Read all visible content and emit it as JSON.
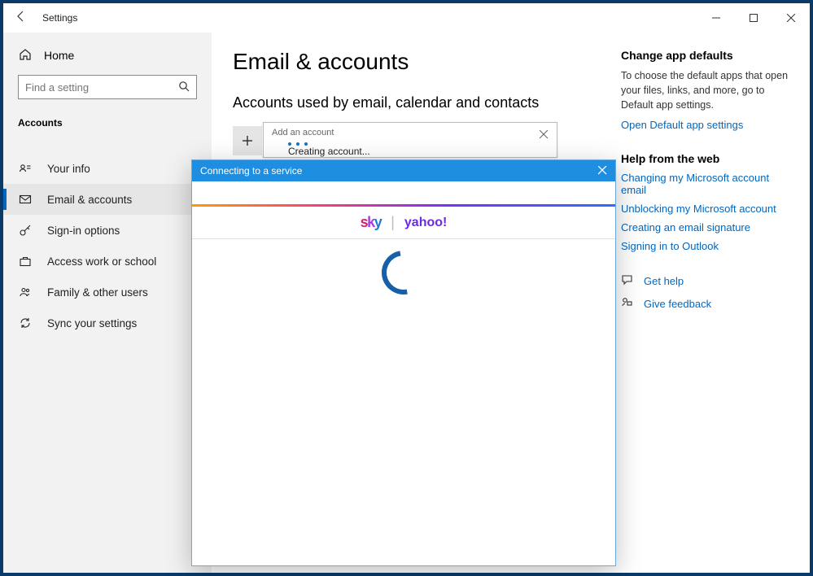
{
  "window": {
    "title": "Settings"
  },
  "sidebar": {
    "home": "Home",
    "search_placeholder": "Find a setting",
    "section": "Accounts",
    "items": [
      {
        "label": "Your info"
      },
      {
        "label": "Email & accounts"
      },
      {
        "label": "Sign-in options"
      },
      {
        "label": "Access work or school"
      },
      {
        "label": "Family & other users"
      },
      {
        "label": "Sync your settings"
      }
    ]
  },
  "main": {
    "title": "Email & accounts",
    "section_heading": "Accounts used by email, calendar and contacts",
    "add_account_label": "Add an account"
  },
  "aside": {
    "defaults_heading": "Change app defaults",
    "defaults_desc": "To choose the default apps that open your files, links, and more, go to Default app settings.",
    "open_defaults_link": "Open Default app settings",
    "help_heading": "Help from the web",
    "help_links": [
      "Changing my Microsoft account email",
      "Unblocking my Microsoft account",
      "Creating an email signature",
      "Signing in to Outlook"
    ],
    "get_help": "Get help",
    "give_feedback": "Give feedback"
  },
  "popup": {
    "title": "Add an account",
    "message": "Creating account..."
  },
  "dialog": {
    "title": "Connecting to a service",
    "brand_left": "sky",
    "brand_right": "yahoo!"
  }
}
